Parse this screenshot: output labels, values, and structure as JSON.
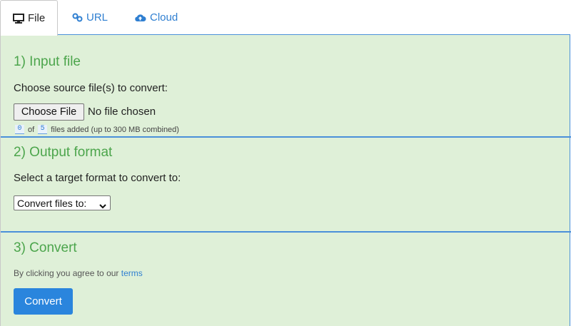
{
  "tabs": [
    {
      "label": "File",
      "icon": "monitor-icon",
      "active": true
    },
    {
      "label": "URL",
      "icon": "link-icon",
      "active": false
    },
    {
      "label": "Cloud",
      "icon": "cloud-upload-icon",
      "active": false
    }
  ],
  "colors": {
    "panel_bg": "#dff0d8",
    "heading": "#4ca54c",
    "link": "#2f7fd1",
    "separator": "#4a90d9",
    "primary_button": "#2a85dd"
  },
  "input_section": {
    "title": "1) Input file",
    "instruction": "Choose source file(s) to convert:",
    "choose_button": "Choose File",
    "file_status": "No file chosen",
    "files_added": "0",
    "of_text": "of",
    "files_max": "5",
    "files_suffix": "files added (up to 300 MB combined)"
  },
  "output_section": {
    "title": "2) Output format",
    "instruction": "Select a target format to convert to:",
    "select_value": "Convert files to:"
  },
  "convert_section": {
    "title": "3) Convert",
    "agree_text": "By clicking you agree to our",
    "terms_link": "terms",
    "convert_button": "Convert"
  }
}
